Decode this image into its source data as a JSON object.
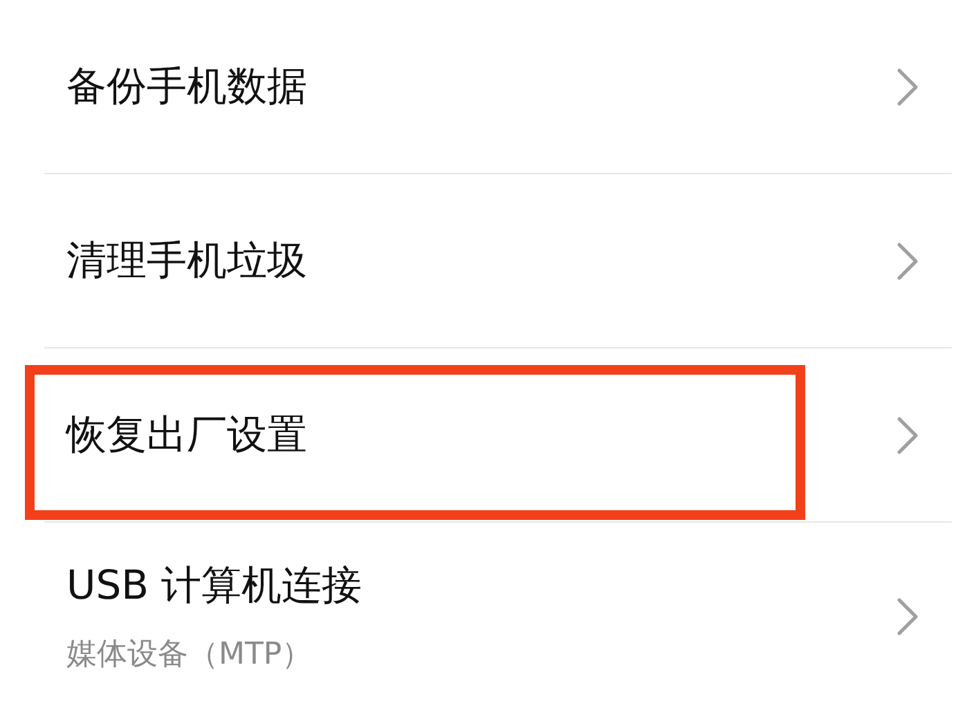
{
  "items": [
    {
      "title": "备份手机数据",
      "highlighted": false
    },
    {
      "title": "清理手机垃圾",
      "highlighted": false
    },
    {
      "title": "恢复出厂设置",
      "highlighted": true
    },
    {
      "title": "USB 计算机连接",
      "subtitle": "媒体设备（MTP）",
      "highlighted": false
    }
  ]
}
